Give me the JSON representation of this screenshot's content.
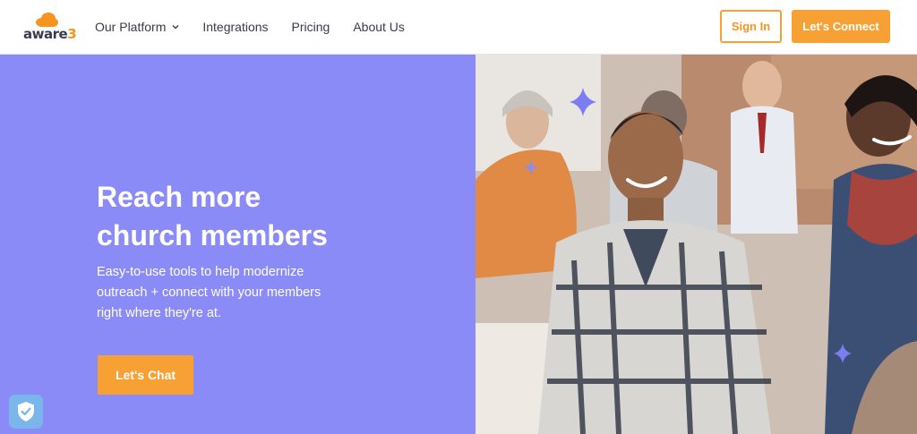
{
  "brand": {
    "logo_main": "aware",
    "logo_accent": "3",
    "accent_color": "#f7a134",
    "hero_bg_color": "#8b8bf8"
  },
  "nav": {
    "items": [
      {
        "label": "Our Platform",
        "has_dropdown": true
      },
      {
        "label": "Integrations",
        "has_dropdown": false
      },
      {
        "label": "Pricing",
        "has_dropdown": false
      },
      {
        "label": "About Us",
        "has_dropdown": false
      }
    ],
    "sign_in_label": "Sign In",
    "connect_label": "Let's Connect"
  },
  "hero": {
    "title_lines": [
      "Reach more",
      "church members"
    ],
    "subtitle_lines": [
      "Easy-to-use tools to help modernize",
      "outreach + connect with your members",
      "right where they're at."
    ],
    "cta_label": "Let's Chat"
  },
  "icons": {
    "logo": "cloud-logo-icon",
    "dropdown": "chevron-down-icon",
    "privacy": "shield-check-icon",
    "sparkles": "sparkle-icon"
  }
}
